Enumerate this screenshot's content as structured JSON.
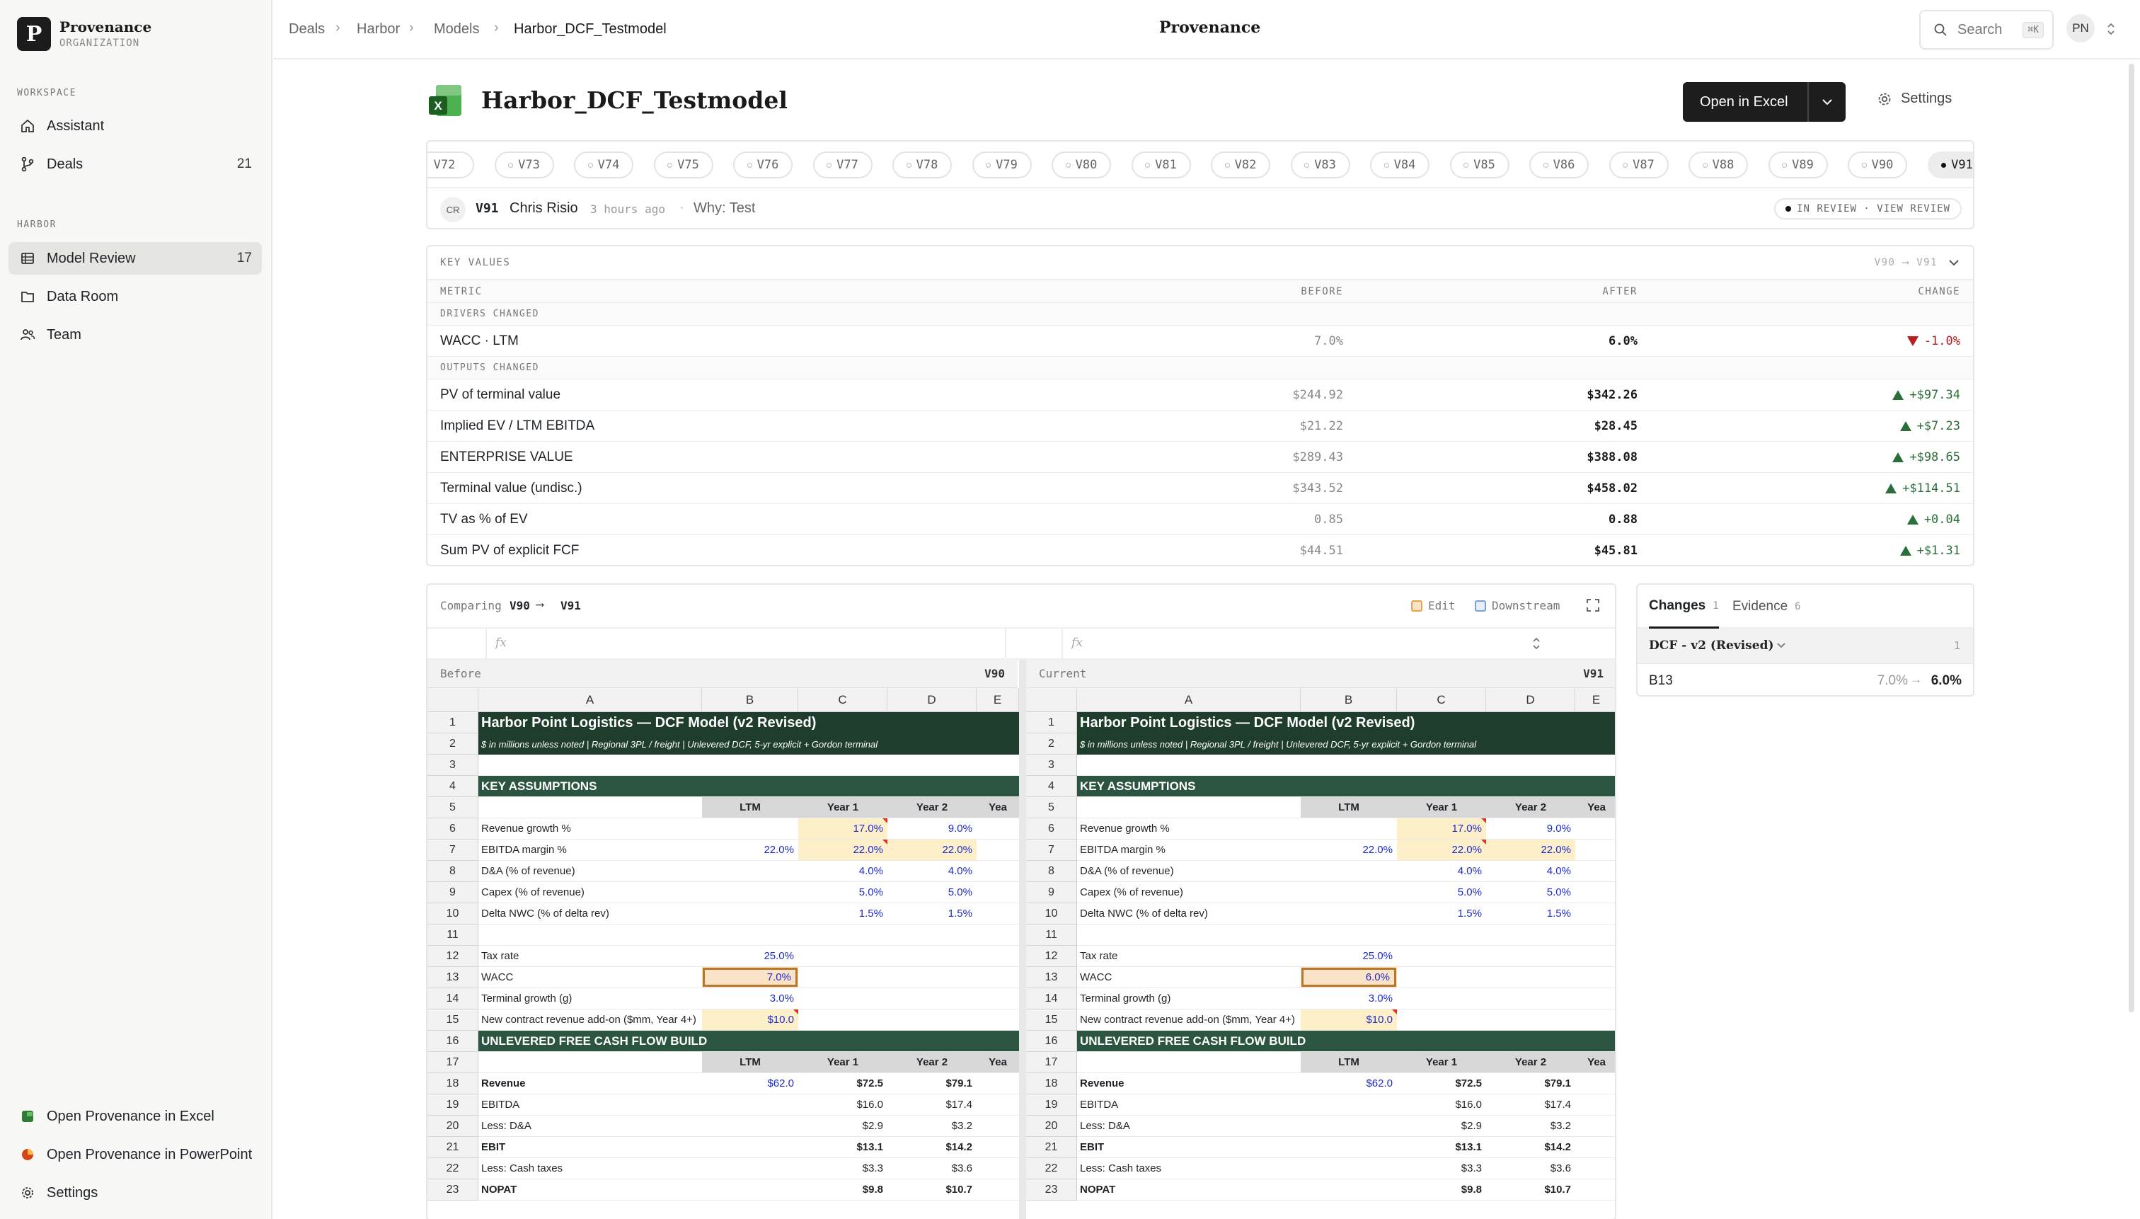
{
  "sidebar": {
    "org_name": "Provenance",
    "org_sub": "ORGANIZATION",
    "logo_letter": "P",
    "workspace_label": "WORKSPACE",
    "harbor_label": "HARBOR",
    "items": [
      {
        "label": "Assistant",
        "count": ""
      },
      {
        "label": "Deals",
        "count": "21"
      },
      {
        "label": "Model Review",
        "count": "17"
      },
      {
        "label": "Data Room",
        "count": ""
      },
      {
        "label": "Team",
        "count": ""
      }
    ],
    "footer": [
      {
        "label": "Open Provenance in Excel"
      },
      {
        "label": "Open Provenance in PowerPoint"
      },
      {
        "label": "Settings"
      }
    ]
  },
  "header": {
    "breadcrumb": [
      "Deals",
      "Harbor",
      "Models",
      "Harbor_DCF_Testmodel"
    ],
    "brand": "Provenance",
    "search_label": "Search",
    "search_kbd": "⌘K",
    "avatar": "PN"
  },
  "page": {
    "title": "Harbor_DCF_Testmodel",
    "open_excel": "Open in Excel",
    "settings": "Settings"
  },
  "versions": {
    "chips": [
      "V72",
      "V73",
      "V74",
      "V75",
      "V76",
      "V77",
      "V78",
      "V79",
      "V80",
      "V81",
      "V82",
      "V83",
      "V84",
      "V85",
      "V86",
      "V87",
      "V88",
      "V89",
      "V90",
      "V91"
    ],
    "selected": "V91",
    "commit": {
      "initials": "CR",
      "version": "V91",
      "author": "Chris Risio",
      "time": "3 hours ago",
      "why": "Why: Test",
      "status": "IN REVIEW · VIEW REVIEW"
    }
  },
  "key_values": {
    "title": "KEY VALUES",
    "range": "V90 ⟶ V91",
    "columns": [
      "METRIC",
      "BEFORE",
      "AFTER",
      "CHANGE"
    ],
    "sections": [
      {
        "label": "DRIVERS CHANGED",
        "rows": [
          {
            "metric": "WACC · LTM",
            "before": "7.0%",
            "after": "6.0%",
            "change": "-1.0%",
            "dir": "down"
          }
        ]
      },
      {
        "label": "OUTPUTS CHANGED",
        "rows": [
          {
            "metric": "PV of terminal value",
            "before": "$244.92",
            "after": "$342.26",
            "change": "+$97.34",
            "dir": "up"
          },
          {
            "metric": "Implied EV / LTM EBITDA",
            "before": "$21.22",
            "after": "$28.45",
            "change": "+$7.23",
            "dir": "up"
          },
          {
            "metric": "ENTERPRISE VALUE",
            "before": "$289.43",
            "after": "$388.08",
            "change": "+$98.65",
            "dir": "up"
          },
          {
            "metric": "Terminal value (undisc.)",
            "before": "$343.52",
            "after": "$458.02",
            "change": "+$114.51",
            "dir": "up"
          },
          {
            "metric": "TV as % of EV",
            "before": "0.85",
            "after": "0.88",
            "change": "+0.04",
            "dir": "up"
          },
          {
            "metric": "Sum PV of explicit FCF",
            "before": "$44.51",
            "after": "$45.81",
            "change": "+$1.31",
            "dir": "up"
          }
        ]
      }
    ]
  },
  "compare": {
    "label": "Comparing",
    "from": "V90",
    "to": "V91",
    "legend_edit": "Edit",
    "legend_down": "Downstream",
    "fx": "fx",
    "left": {
      "label": "Before",
      "version": "V90",
      "wacc": "7.0%"
    },
    "right": {
      "label": "Current",
      "version": "V91",
      "wacc": "6.0%"
    },
    "columns": [
      "A",
      "B",
      "C",
      "D",
      "E"
    ],
    "sheet_title": "Harbor Point Logistics  —  DCF Model  (v2 Revised)",
    "sheet_sub": "$ in millions unless noted   |   Regional 3PL / freight   |   Unlevered DCF, 5-yr explicit + Gordon terminal",
    "key_assumptions": "KEY ASSUMPTIONS",
    "ufcf": "UNLEVERED FREE CASH FLOW BUILD",
    "hdr": [
      "LTM",
      "Year 1",
      "Year 2",
      "Yea"
    ],
    "assumptions": [
      {
        "label": "Revenue growth %",
        "b": "",
        "c": "17.0%",
        "d": "9.0%"
      },
      {
        "label": "EBITDA margin %",
        "b": "22.0%",
        "c": "22.0%",
        "d": "22.0%"
      },
      {
        "label": "D&A (% of revenue)",
        "b": "",
        "c": "4.0%",
        "d": "4.0%"
      },
      {
        "label": "Capex (% of revenue)",
        "b": "",
        "c": "5.0%",
        "d": "5.0%"
      },
      {
        "label": "Delta NWC (% of delta rev)",
        "b": "",
        "c": "1.5%",
        "d": "1.5%"
      }
    ],
    "tax": {
      "label": "Tax rate",
      "b": "25.0%"
    },
    "wacc_label": "WACC",
    "tg": {
      "label": "Terminal growth (g)",
      "b": "3.0%"
    },
    "addon": {
      "label": "New contract revenue add-on ($mm, Year 4+)",
      "b": "$10.0"
    },
    "build": [
      {
        "label": "Revenue",
        "b": "$62.0",
        "c": "$72.5",
        "d": "$79.1",
        "bold": true
      },
      {
        "label": "EBITDA",
        "b": "",
        "c": "$16.0",
        "d": "$17.4",
        "bold": false
      },
      {
        "label": "Less: D&A",
        "b": "",
        "c": "$2.9",
        "d": "$3.2",
        "bold": false
      },
      {
        "label": "EBIT",
        "b": "",
        "c": "$13.1",
        "d": "$14.2",
        "bold": true
      },
      {
        "label": "Less: Cash taxes",
        "b": "",
        "c": "$3.3",
        "d": "$3.6",
        "bold": false
      },
      {
        "label": "NOPAT",
        "b": "",
        "c": "$9.8",
        "d": "$10.7",
        "bold": true
      }
    ]
  },
  "changes_panel": {
    "tab_changes": "Changes",
    "changes_count": "1",
    "tab_evidence": "Evidence",
    "evidence_count": "6",
    "group": "DCF - v2 (Revised)",
    "group_count": "1",
    "cell": "B13",
    "before": "7.0%",
    "after": "6.0%"
  },
  "colors": {
    "accent_dark": "#1d1d1d",
    "sheet_banner": "#1f3d2d",
    "sheet_band": "#2b5540",
    "pos": "#2c6e3a",
    "neg": "#b91c1c"
  }
}
